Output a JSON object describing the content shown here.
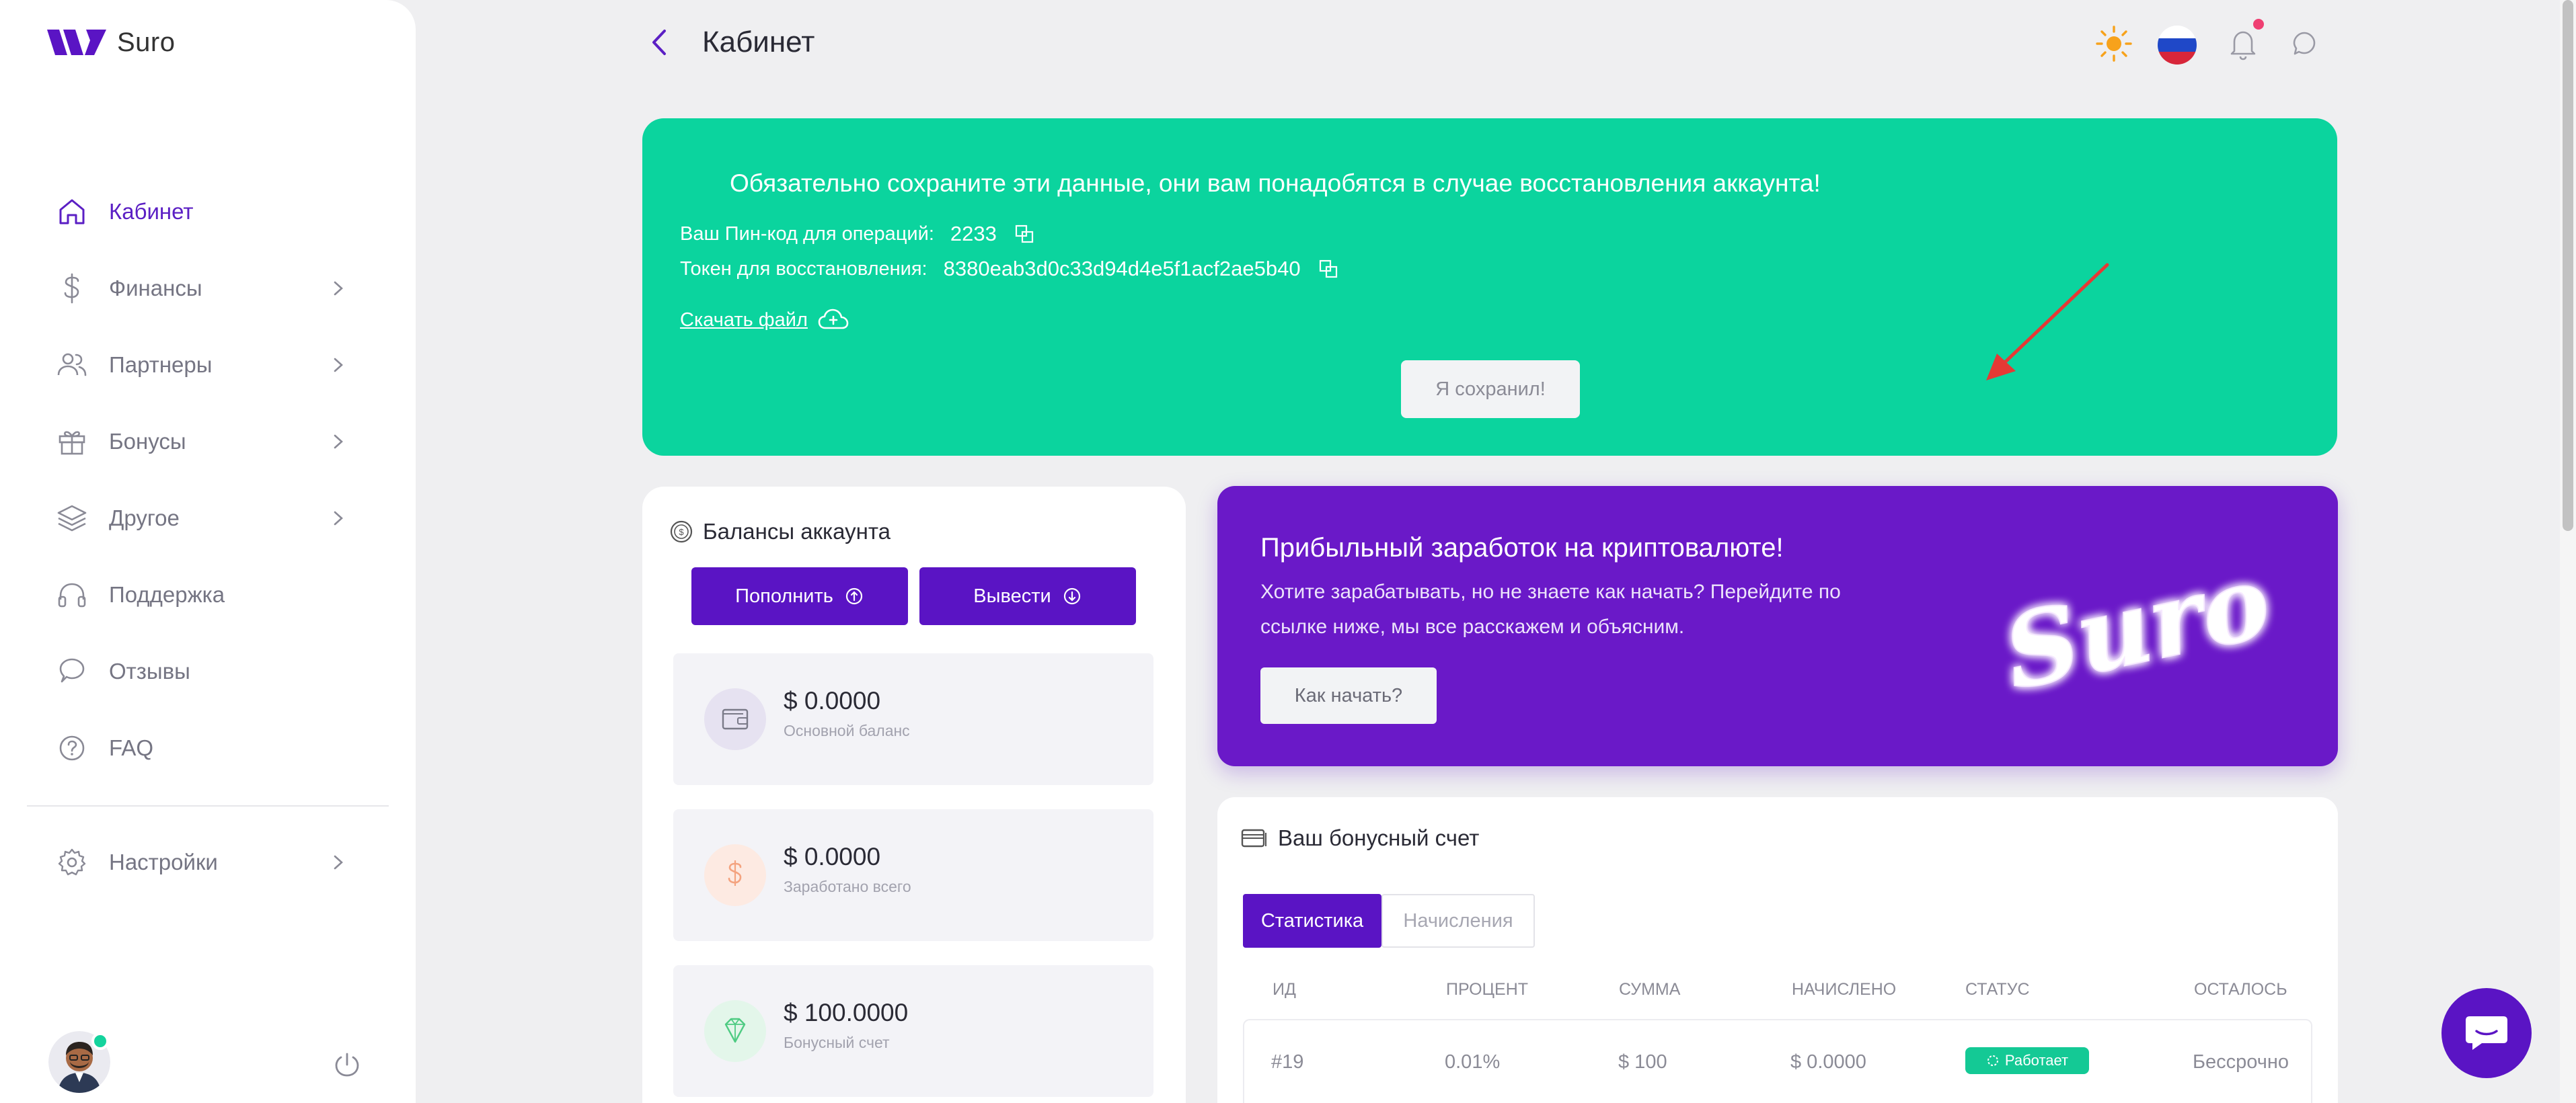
{
  "app": {
    "name": "Suro"
  },
  "header": {
    "title": "Кабинет"
  },
  "sidebar": {
    "items": [
      {
        "label": "Кабинет",
        "icon": "home-icon",
        "active": true
      },
      {
        "label": "Финансы",
        "icon": "dollar-icon"
      },
      {
        "label": "Партнеры",
        "icon": "users-icon"
      },
      {
        "label": "Бонусы",
        "icon": "gift-icon"
      },
      {
        "label": "Другое",
        "icon": "layers-icon"
      },
      {
        "label": "Поддержка",
        "icon": "headphones-icon"
      },
      {
        "label": "Отзывы",
        "icon": "message-icon"
      },
      {
        "label": "FAQ",
        "icon": "question-icon"
      }
    ],
    "settings": {
      "label": "Настройки",
      "icon": "gear-icon"
    }
  },
  "banner": {
    "headline": "Обязательно сохраните эти данные, они вам понадобятся в случае восстановления аккаунта!",
    "pin_label": "Ваш Пин-код для операций:",
    "pin_value": "2233",
    "token_label": "Токен для восстановления:",
    "token_value": "8380eab3d0c33d94d4e5f1acf2ae5b40",
    "download_label": "Скачать файл",
    "saved_button": "Я сохранил!"
  },
  "balances": {
    "title": "Балансы аккаунта",
    "deposit_button": "Пополнить",
    "withdraw_button": "Вывести",
    "items": [
      {
        "amount": "$ 0.0000",
        "label": "Основной баланс"
      },
      {
        "amount": "$ 0.0000",
        "label": "Заработано всего"
      },
      {
        "amount": "$ 100.0000",
        "label": "Бонусный счет"
      }
    ]
  },
  "promo": {
    "title": "Прибыльный заработок на криптовалюте!",
    "text": "Хотите зарабатывать, но не знаете как начать? Перейдите по ссылке ниже, мы все расскажем и объясним.",
    "button": "Как начать?",
    "logo_text": "Suro"
  },
  "bonus": {
    "title": "Ваш бонусный счет",
    "tabs": [
      "Статистика",
      "Начисления"
    ],
    "columns": [
      "ИД",
      "ПРОЦЕНТ",
      "СУММА",
      "НАЧИСЛЕНО",
      "СТАТУС",
      "ОСТАЛОСЬ"
    ],
    "rows": [
      {
        "id": "#19",
        "percent": "0.01%",
        "sum": "$ 100",
        "accrued": "$ 0.0000",
        "status": "Работает",
        "remaining": "Бессрочно"
      }
    ]
  },
  "colors": {
    "brand": "#5a14c4",
    "banner": "#0bd49e",
    "promo": "#6a19c8",
    "status": "#14c995"
  }
}
